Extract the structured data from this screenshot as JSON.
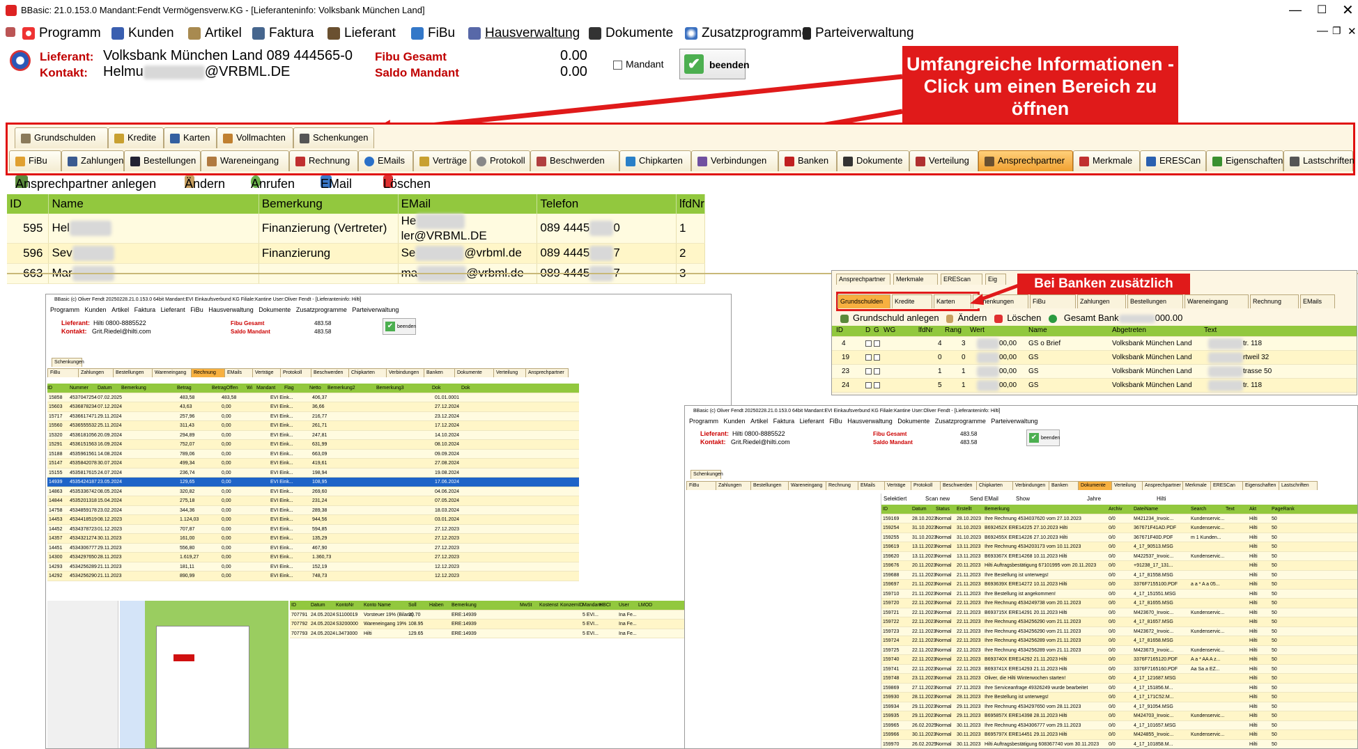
{
  "window": {
    "title": "BBasic: 21.0.153.0 Mandant:Fendt Vermögensverw.KG  - [Lieferanteninfo: Volksbank München Land]"
  },
  "menu": [
    "Programm",
    "Kunden",
    "Artikel",
    "Faktura",
    "Lieferant",
    "FiBu",
    "Hausverwaltung",
    "Dokumente",
    "Zusatzprogramme",
    "Parteiverwaltung"
  ],
  "header": {
    "lieferant_label": "Lieferant:",
    "lieferant_value": "Volksbank München Land 089 444565-0",
    "kontakt_label": "Kontakt:",
    "kontakt_value_a": "Helmu",
    "kontakt_value_b": "@VRBML.DE",
    "fibu_label": "Fibu Gesamt",
    "fibu_value": "0.00",
    "saldo_label": "Saldo Mandant",
    "saldo_value": "0.00",
    "mandant_label": "Mandant",
    "beenden_label": "beenden"
  },
  "callout_main": "Umfangreiche Informationen - Click um einen Bereich zu öffnen",
  "callout_banken": "Bei Banken zusätzlich",
  "tabs_row1": [
    "Grundschulden",
    "Kredite",
    "Karten",
    "Vollmachten",
    "Schenkungen"
  ],
  "tabs_row2": [
    "FiBu",
    "Zahlungen",
    "Bestellungen",
    "Wareneingang",
    "Rechnung",
    "EMails",
    "Verträge",
    "Protokoll",
    "Beschwerden",
    "Chipkarten",
    "Verbindungen",
    "Banken",
    "Dokumente",
    "Verteilung",
    "Ansprechpartner",
    "Merkmale",
    "ERESCan",
    "Eigenschaften",
    "Lastschriften"
  ],
  "active_tab": "Ansprechpartner",
  "toolbar": {
    "anlegen": "Ansprechpartner anlegen",
    "aendern": "Ändern",
    "anrufen": "Anrufen",
    "email": "EMail",
    "loeschen": "Löschen"
  },
  "contacts": {
    "columns": [
      "ID",
      "Name",
      "Bemerkung",
      "EMail",
      "Telefon",
      "lfdNr"
    ],
    "rows": [
      {
        "id": "595",
        "name": "Hel",
        "bem": "Finanzierung (Vertreter)",
        "email_a": "He",
        "email_b": "ler@VRBML.DE",
        "tel_a": "089 4445",
        "tel_b": "0",
        "nr": "1"
      },
      {
        "id": "596",
        "name": "Sev",
        "bem": "Finanzierung",
        "email_a": "Se",
        "email_b": "@vrbml.de",
        "tel_a": "089 4445",
        "tel_b": "7",
        "nr": "2"
      },
      {
        "id": "663",
        "name": "Mar",
        "bem": "",
        "email_a": "ma",
        "email_b": "@vrbml.de",
        "tel_a": "089 4445",
        "tel_b": "7",
        "nr": "3"
      }
    ]
  },
  "banken_panel": {
    "tabs_top": [
      "Ansprechpartner",
      "Merkmale",
      "EREScan",
      "Eig"
    ],
    "tabs_sub": [
      "Grundschulden",
      "Kredite",
      "Karten",
      "Schenkungen",
      "FiBu",
      "Zahlungen",
      "Bestellungen",
      "Wareneingang",
      "Rechnung",
      "EMails"
    ],
    "toolbar": {
      "anlegen": "Grundschuld anlegen",
      "aendern": "Ändern",
      "loeschen": "Löschen",
      "gesamt_a": "Gesamt Bank",
      "gesamt_b": "000.00"
    },
    "columns": [
      "ID",
      "D",
      "G",
      "WG",
      "lfdNr",
      "Rang",
      "Wert",
      "Name",
      "Abgetreten",
      "Text"
    ],
    "rows": [
      {
        "id": "4",
        "nr": "4",
        "rang": "3",
        "wert": "00,00",
        "name": "GS o Brief",
        "abg": "Volksbank München Land",
        "text": "tr. 118"
      },
      {
        "id": "19",
        "nr": "0",
        "rang": "0",
        "wert": "00,00",
        "name": "GS",
        "abg": "Volksbank München Land",
        "text": "rtweil 32"
      },
      {
        "id": "23",
        "nr": "1",
        "rang": "1",
        "wert": "00,00",
        "name": "GS",
        "abg": "Volksbank München Land",
        "text": "trasse 50"
      },
      {
        "id": "24",
        "nr": "5",
        "rang": "1",
        "wert": "00,00",
        "name": "GS",
        "abg": "Volksbank München Land",
        "text": "tr. 118"
      }
    ]
  },
  "rechnung_panel": {
    "title": "BBasic (c) Oliver Fendt 20250228.21.0.153.0 64bit Mandant:EVI Einkaufsverbund KG Filiale:Kantine User:Oliver Fendt - [Lieferanteninfo: Hilti]",
    "lieferant": "Hilti 0800-8885522",
    "kontakt": "Grit.Riedel@hilti.com",
    "fibu": "483.58",
    "saldo": "483.58",
    "columns": [
      "ID",
      "Nummer",
      "Datum",
      "Bemerkung",
      "Betrag",
      "BetragOffen",
      "Wi",
      "Mandant",
      "Flag",
      "Netto",
      "Bemerkung2",
      "Bemerkung3",
      "Dok",
      "Dok"
    ],
    "rows": [
      [
        "15858",
        "4537047254",
        "07.02.2025",
        "483,58",
        "483,58",
        "EVI Eink...",
        "406,37",
        "01.01.0001"
      ],
      [
        "15603",
        "4536878234",
        "07.12.2024",
        "43,63",
        "0,00",
        "EVI Eink...",
        "36,66",
        "27.12.2024"
      ],
      [
        "15717",
        "4536617471",
        "29.11.2024",
        "257,96",
        "0,00",
        "EVI Eink...",
        "216,77",
        "23.12.2024"
      ],
      [
        "15560",
        "4536555532",
        "25.11.2024",
        "311,43",
        "0,00",
        "EVI Eink...",
        "261,71",
        "17.12.2024"
      ],
      [
        "15320",
        "4536181056",
        "20.09.2024",
        "294,89",
        "0,00",
        "EVI Eink...",
        "247,81",
        "14.10.2024"
      ],
      [
        "15291",
        "4536151563",
        "16.09.2024",
        "752,07",
        "0,00",
        "EVI Eink...",
        "631,99",
        "08.10.2024"
      ],
      [
        "15188",
        "4535961561",
        "14.08.2024",
        "789,06",
        "0,00",
        "EVI Eink...",
        "663,09",
        "09.09.2024"
      ],
      [
        "15147",
        "4535842078",
        "30.07.2024",
        "499,34",
        "0,00",
        "EVI Eink...",
        "419,61",
        "27.08.2024"
      ],
      [
        "15155",
        "4535817615",
        "24.07.2024",
        "236,74",
        "0,00",
        "EVI Eink...",
        "198,94",
        "19.08.2024"
      ],
      [
        "14939",
        "4535424187",
        "23.05.2024",
        "129,65",
        "0,00",
        "EVI Eink...",
        "108,95",
        "17.06.2024"
      ],
      [
        "14863",
        "4535336742",
        "08.05.2024",
        "320,82",
        "0,00",
        "EVI Eink...",
        "269,60",
        "04.06.2024"
      ],
      [
        "14844",
        "4535201318",
        "15.04.2024",
        "275,18",
        "0,00",
        "EVI Eink...",
        "231,24",
        "07.05.2024"
      ],
      [
        "14758",
        "4534859178",
        "23.02.2024",
        "344,36",
        "0,00",
        "EVI Eink...",
        "289,38",
        "18.03.2024"
      ],
      [
        "14453",
        "4534418519",
        "08.12.2023",
        "1.124,03",
        "0,00",
        "EVI Eink...",
        "944,56",
        "03.01.2024"
      ],
      [
        "14452",
        "4534378723",
        "01.12.2023",
        "707,87",
        "0,00",
        "EVI Eink...",
        "594,85",
        "27.12.2023"
      ],
      [
        "14357",
        "4534321274",
        "30.11.2023",
        "161,00",
        "0,00",
        "EVI Eink...",
        "135,29",
        "27.12.2023"
      ],
      [
        "14451",
        "4534306777",
        "29.11.2023",
        "556,80",
        "0,00",
        "EVI Eink...",
        "467,90",
        "27.12.2023"
      ],
      [
        "14300",
        "4534297650",
        "28.11.2023",
        "1.619,27",
        "0,00",
        "EVI Eink...",
        "1.360,73",
        "27.12.2023"
      ],
      [
        "14293",
        "4534256289",
        "21.11.2023",
        "181,11",
        "0,00",
        "EVI Eink...",
        "152,19",
        "12.12.2023"
      ],
      [
        "14292",
        "4534256290",
        "21.11.2023",
        "890,99",
        "0,00",
        "EVI Eink...",
        "748,73",
        "12.12.2023"
      ]
    ],
    "booking_columns": [
      "ID",
      "Datum",
      "KontoNr",
      "Konto Name",
      "Soll",
      "Haben",
      "Bemerkung",
      "MwSt",
      "Kostenst",
      "KonzernID",
      "Mandant",
      "HBCI",
      "User",
      "LMOD"
    ],
    "bookings": [
      [
        "707791",
        "24.05.2024",
        "S1100019",
        "Vorsteuer 19% (Bilanz)",
        "20.70",
        "ERE:14939",
        "5 EVI...",
        "Ina Fe..."
      ],
      [
        "707792",
        "24.05.2024",
        "S3200000",
        "Wareneingang 19%",
        "108.95",
        "ERE:14939",
        "5 EVI...",
        "Ina Fe..."
      ],
      [
        "707793",
        "24.05.2024",
        "L3473000",
        "Hilti",
        "129.65",
        "ERE:14939",
        "5 EVI...",
        "Ina Fe..."
      ]
    ]
  },
  "dokumente_panel": {
    "title": "BBasic (c) Oliver Fendt 20250228.21.0.153.0 64bit Mandant:EVI Einkaufsverbund KG Filiale:Kantine User:Oliver Fendt - [Lieferanteninfo: Hilti]",
    "lieferant": "Hilti 0800-8885522",
    "kontakt": "Grit.Riedel@hilti.com",
    "fibu": "483.58",
    "saldo": "483.58",
    "toolbar": [
      "Selektiert",
      "Scan new",
      "Send EMail",
      "Show",
      "Jahre",
      "Hilti"
    ],
    "columns": [
      "ID",
      "Datum",
      "Status",
      "Erstellt",
      "Bemerkung",
      "Archiv",
      "DateiName",
      "Search",
      "Text",
      "Akt",
      "PageRank"
    ],
    "rows": [
      [
        "159169",
        "28.10.2023",
        "Normal",
        "28.10.2023",
        "Ihre Rechnung 4534037620 vom 27.10.2023",
        "0/0",
        "M421234_Invoic...",
        "Kundenservic..."
      ],
      [
        "159254",
        "31.10.2023",
        "Normal",
        "31.10.2023",
        "B692452X ERE14225 27.10.2023 Hilti",
        "0/0",
        "367671F41AD.PDF",
        "Kundenservic..."
      ],
      [
        "159255",
        "31.10.2023",
        "Normal",
        "31.10.2023",
        "B692455X ERE14226 27.10.2023 Hilti",
        "0/0",
        "367671F40D.PDF",
        "m 1 Kunden..."
      ],
      [
        "159619",
        "13.11.2023",
        "Normal",
        "13.11.2023",
        "Ihre Rechnung 4534203173 vom 10.11.2023",
        "0/0",
        "4_17_90513.MSG",
        ""
      ],
      [
        "159620",
        "13.11.2023",
        "Normal",
        "13.11.2023",
        "B693367X ERE14268 10.11.2023 Hilti",
        "0/0",
        "M422537_Invoic...",
        "Kundenservic..."
      ],
      [
        "159676",
        "20.11.2023",
        "Normal",
        "20.11.2023",
        "Hilti Auftragsbestätigung 67101995 vom 20.11.2023",
        "0/0",
        "+91238_17_131...",
        ""
      ],
      [
        "159688",
        "21.11.2023",
        "Normal",
        "21.11.2023",
        "Ihre Bestellung ist unterwegs!",
        "0/0",
        "4_17_81558.MSG",
        ""
      ],
      [
        "159697",
        "21.11.2023",
        "Normal",
        "21.11.2023",
        "B693639X ERE14272 10.11.2023 Hilti",
        "0/0",
        "3376F7155100.PDF",
        "a a * A a 05..."
      ],
      [
        "159710",
        "21.11.2023",
        "Normal",
        "21.11.2023",
        "Ihre Bestellung ist angekommen!",
        "0/0",
        "4_17_151551.MSG",
        ""
      ],
      [
        "159720",
        "22.11.2023",
        "Normal",
        "22.11.2023",
        "Ihre Rechnung 4534249738 vom 20.11.2023",
        "0/0",
        "4_17_81655.MSG",
        ""
      ],
      [
        "159721",
        "22.11.2023",
        "Normal",
        "22.11.2023",
        "B693715X ERE14291 20.11.2023 Hilti",
        "0/0",
        "M423670_Invoic...",
        "Kundenservic..."
      ],
      [
        "159722",
        "22.11.2023",
        "Normal",
        "22.11.2023",
        "Ihre Rechnung 4534256290 vom 21.11.2023",
        "0/0",
        "4_17_81657.MSG",
        ""
      ],
      [
        "159723",
        "22.11.2023",
        "Normal",
        "22.11.2023",
        "Ihre Rechnung 4534256290 vom 21.11.2023",
        "0/0",
        "M423672_Invoic...",
        "Kundenservic..."
      ],
      [
        "159724",
        "22.11.2023",
        "Normal",
        "22.11.2023",
        "Ihre Rechnung 4534256289 vom 21.11.2023",
        "0/0",
        "4_17_81658.MSG",
        ""
      ],
      [
        "159725",
        "22.11.2023",
        "Normal",
        "22.11.2023",
        "Ihre Rechnung 4534256289 vom 21.11.2023",
        "0/0",
        "M423673_Invoic...",
        "Kundenservic..."
      ],
      [
        "159740",
        "22.11.2023",
        "Normal",
        "22.11.2023",
        "B693740X ERE14292 21.11.2023 Hilti",
        "0/0",
        "3376F7165120.PDF",
        "A a * AA A z..."
      ],
      [
        "159741",
        "22.11.2023",
        "Normal",
        "22.11.2023",
        "B693741X ERE14293 21.11.2023 Hilti",
        "0/0",
        "3376F7165160.PDF",
        "Aa Sa a EZ..."
      ],
      [
        "159748",
        "23.11.2023",
        "Normal",
        "23.11.2023",
        "Oliver, die Hilti Winterwochen starten!",
        "0/0",
        "4_17_121687.MSG",
        ""
      ],
      [
        "159869",
        "27.11.2023",
        "Normal",
        "27.11.2023",
        "Ihre Serviceanfrage 49326249 wurde bearbeitet",
        "0/0",
        "4_17_151856.M...",
        ""
      ],
      [
        "159930",
        "28.11.2023",
        "Normal",
        "28.11.2023",
        "Ihre Bestellung ist unterwegs!",
        "0/0",
        "4_17_171C52.M...",
        ""
      ],
      [
        "159934",
        "29.11.2023",
        "Normal",
        "29.11.2023",
        "Ihre Rechnung 4534297650 vom 28.11.2023",
        "0/0",
        "4_17_91054.MSG",
        ""
      ],
      [
        "159935",
        "29.11.2023",
        "Normal",
        "29.11.2023",
        "B695857X ERE14398 28.11.2023 Hilti",
        "0/0",
        "M424703_Invoic...",
        "Kundenservic..."
      ],
      [
        "159965",
        "26.02.2025",
        "Normal",
        "30.11.2023",
        "Ihre Rechnung 4534306777 vom 29.11.2023",
        "0/0",
        "4_17_101657.MSG",
        ""
      ],
      [
        "159966",
        "30.11.2023",
        "Normal",
        "30.11.2023",
        "B695797X ERE14451 29.11.2023 Hilti",
        "0/0",
        "M424855_Invoic...",
        "Kundenservic..."
      ],
      [
        "159970",
        "26.02.2025",
        "Normal",
        "30.11.2023",
        "Hilti Auftragsbestätigung 608367740 vom 30.11.2023",
        "0/0",
        "4_17_101858.M...",
        ""
      ]
    ]
  },
  "colors": {
    "accent_red": "#e01a1a",
    "header_green": "#92c83e",
    "row_yellow": "#fff6c8",
    "tab_active": "#f0a030"
  }
}
